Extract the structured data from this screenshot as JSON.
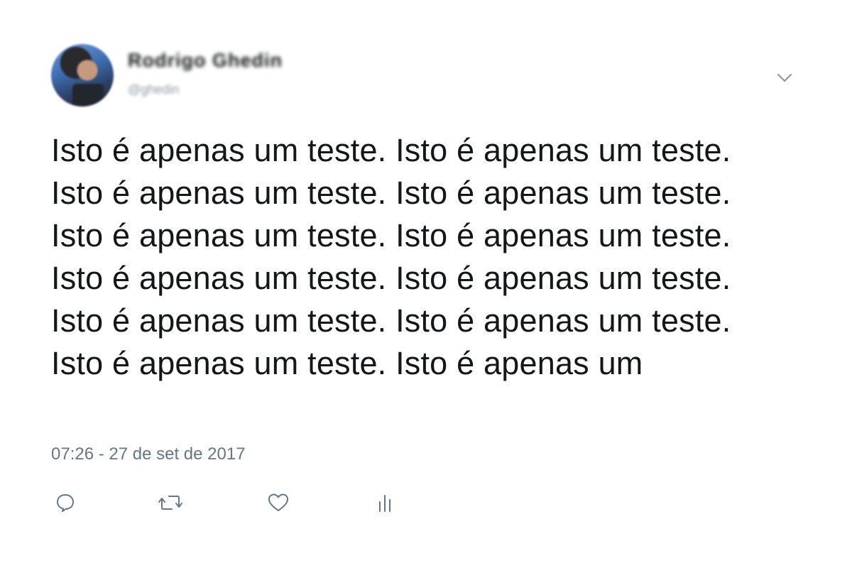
{
  "tweet": {
    "author": {
      "display_name": "Rodrigo Ghedin",
      "handle": "@ghedin",
      "avatar_icon": "user-avatar"
    },
    "menu_icon": "chevron-down-icon",
    "text": "Isto é apenas um teste. Isto é apenas um teste. Isto é apenas um teste. Isto é apenas um teste. Isto é apenas um teste. Isto é apenas um teste. Isto é apenas um teste. Isto é apenas um teste. Isto é apenas um teste. Isto é apenas um teste. Isto é apenas um teste. Isto é apenas um",
    "timestamp": "07:26 - 27 de set de 2017",
    "actions": [
      {
        "name": "reply",
        "icon": "reply-icon"
      },
      {
        "name": "retweet",
        "icon": "retweet-icon"
      },
      {
        "name": "like",
        "icon": "heart-icon"
      },
      {
        "name": "analytics",
        "icon": "analytics-icon"
      }
    ]
  },
  "colors": {
    "text": "#14171a",
    "secondary": "#657786",
    "icon": "#657786",
    "background": "#ffffff"
  }
}
